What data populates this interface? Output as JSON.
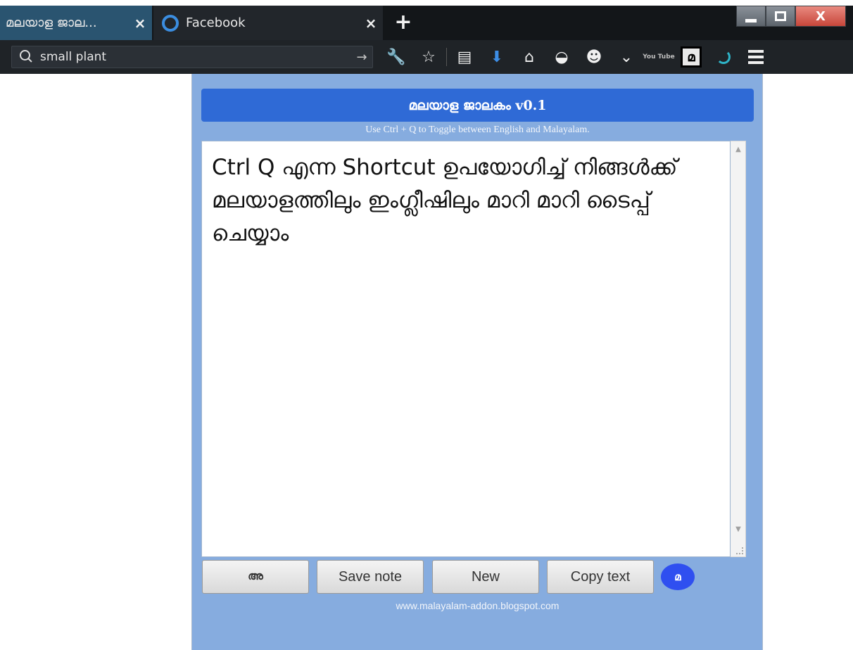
{
  "tabs": [
    {
      "label": "മലയാള ജാല...",
      "close": "×"
    },
    {
      "label": "Facebook",
      "close": "×"
    }
  ],
  "new_tab_label": "+",
  "window_controls": {
    "close": "X"
  },
  "search": {
    "value": "small plant",
    "go": "→"
  },
  "toolbar": {
    "icons": [
      "wrench-icon",
      "star-icon",
      "reading-list-icon",
      "download-icon",
      "home-icon",
      "shield-icon",
      "smiley-icon",
      "pocket-icon",
      "youtube-icon",
      "malayalam-addon-icon",
      "loading-icon",
      "menu-icon"
    ],
    "youtube_text": "You Tube",
    "ml_text": "മ"
  },
  "popup": {
    "title": "മലയാള ജാലകം v0.1",
    "hint": "Use Ctrl + Q to Toggle between English and Malayalam.",
    "editor_text": "Ctrl Q എന്ന Shortcut ഉപയോഗിച്ച് നിങ്ങൾക്ക് മലയാളത്തിലും ഇംഗ്ലീഷിലും മാറി മാറി ടൈപ്പ് ചെയ്യാം",
    "buttons": {
      "lang": "അ",
      "save": "Save note",
      "new": "New",
      "copy": "Copy text",
      "logo": "മ"
    },
    "footer": "www.malayalam-addon.blogspot.com"
  },
  "colors": {
    "popup_bg": "#86acdf",
    "title_bg": "#2f6ad6",
    "logo_bg": "#2f4ff0",
    "active_tab": "#2a5470"
  }
}
